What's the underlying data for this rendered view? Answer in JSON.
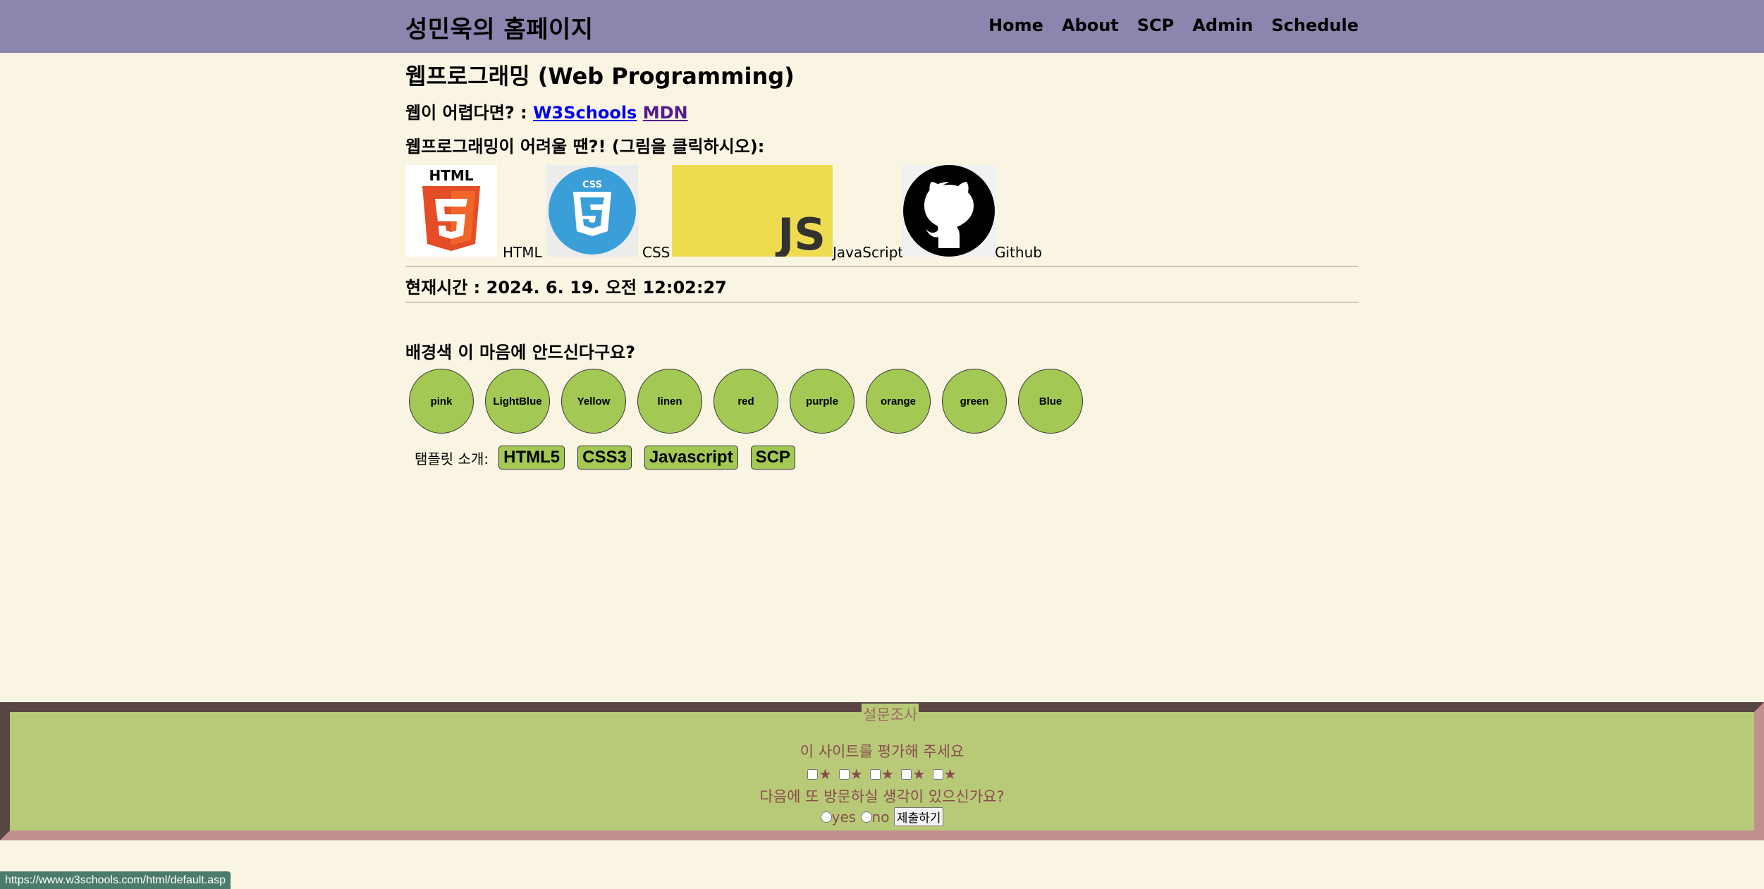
{
  "header": {
    "site_title": "성민욱의 홈페이지",
    "nav": [
      "Home",
      "About",
      "SCP",
      "Admin",
      "Schedule"
    ]
  },
  "main": {
    "title": "웹프로그래밍 (Web Programming)",
    "help_prefix": "웹이 어렵다면? :",
    "links": [
      "W3Schools",
      "MDN"
    ],
    "hard_text": "웹프로그래밍이 어려울 땐?! (그림을 클릭하시오):",
    "logos": [
      {
        "icon": "html5-logo",
        "caption": "HTML"
      },
      {
        "icon": "css3-logo",
        "caption": "CSS"
      },
      {
        "icon": "javascript-logo",
        "caption": "JavaScript"
      },
      {
        "icon": "github-logo",
        "caption": "Github"
      }
    ],
    "clock_label": "현재시간 :",
    "clock_value": "2024. 6. 19. 오전 12:02:27"
  },
  "background": {
    "title": "배경색 이 마음에 안드신다구요?",
    "buttons": [
      "pink",
      "LightBlue",
      "Yellow",
      "linen",
      "red",
      "purple",
      "orange",
      "green",
      "Blue"
    ],
    "button_color": "#a3c854"
  },
  "templates": {
    "label": "탬플릿 소개:",
    "buttons": [
      "HTML5",
      "CSS3",
      "Javascript",
      "SCP"
    ]
  },
  "survey": {
    "legend": "설문조사",
    "q1": "이 사이트를 평가해 주세요",
    "star_glyph": "★",
    "star_count": 5,
    "q2": "다음에 또 방문하실 생각이 있으신가요?",
    "yes": "yes",
    "no": "no",
    "submit": "제출하기"
  },
  "status_url": "https://www.w3schools.com/html/default.asp",
  "colors": {
    "header_bg": "#8c86ae",
    "page_bg": "#faf4e3",
    "survey_bg": "#b8ca78",
    "status_bg": "#4b7c6a"
  }
}
